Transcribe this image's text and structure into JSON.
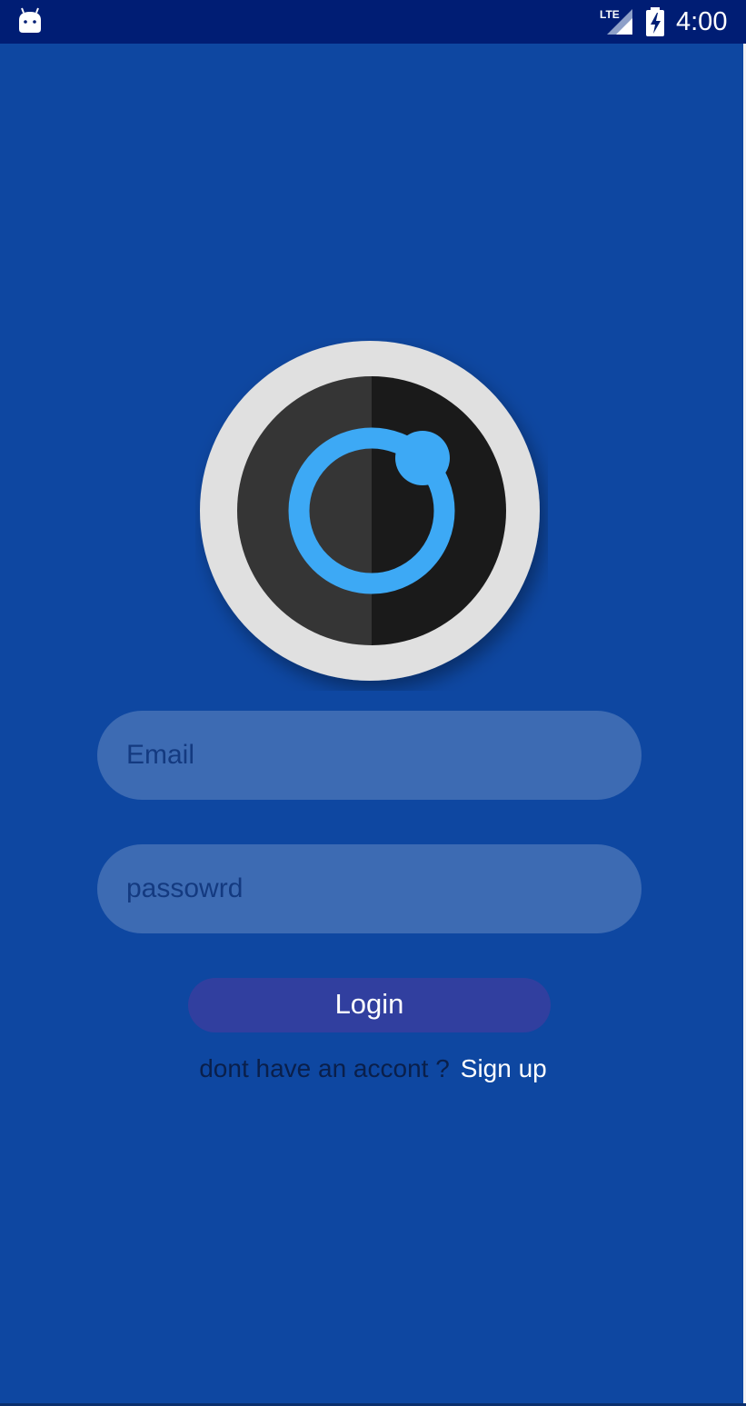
{
  "status_bar": {
    "time": "4:00",
    "network_label": "LTE",
    "icons": [
      "android-icon",
      "lte-signal-icon",
      "battery-charging-icon"
    ]
  },
  "logo": {
    "icon": "camera-lens-logo",
    "colors": {
      "outer_ring": "#e0e0e0",
      "lens_left": "#353535",
      "lens_right": "#1a1a1a",
      "accent": "#3da9f5"
    }
  },
  "form": {
    "email": {
      "placeholder": "Email",
      "value": ""
    },
    "password": {
      "placeholder": "passowrd",
      "value": ""
    },
    "login_label": "Login",
    "signup_prompt": "dont have an accont ?",
    "signup_link": "Sign up"
  },
  "colors": {
    "background": "#0e47a1",
    "status_bar": "#001d74",
    "input_fill": "#3d6bb3",
    "button_fill": "#313f9f"
  }
}
